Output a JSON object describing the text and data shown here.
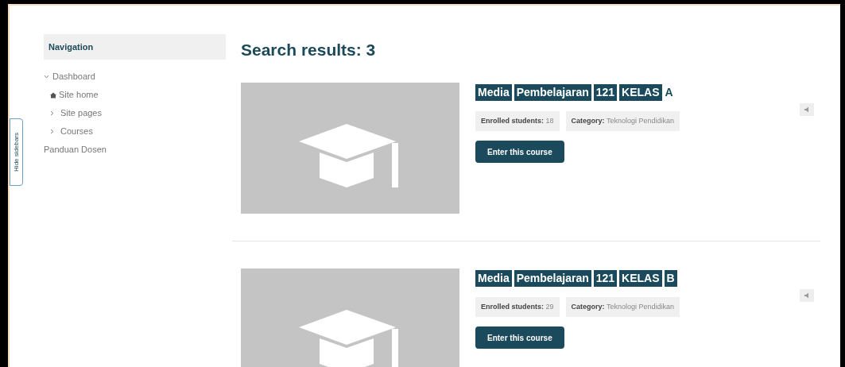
{
  "sidebar_toggle": {
    "label": "Hide sidebars"
  },
  "navigation": {
    "title": "Navigation",
    "items": [
      {
        "label": "Dashboard",
        "kind": "expanded",
        "children": [
          {
            "label": "Site home",
            "kind": "home"
          },
          {
            "label": "Site pages",
            "kind": "collapsed"
          },
          {
            "label": "Courses",
            "kind": "collapsed"
          }
        ]
      },
      {
        "label": "Panduan Dosen",
        "kind": "leaf"
      }
    ]
  },
  "heading": "Search results: 3",
  "courses": [
    {
      "title_words": [
        {
          "text": "Media",
          "highlighted": true
        },
        {
          "text": "Pembelajaran",
          "highlighted": true
        },
        {
          "text": "121",
          "highlighted": true
        },
        {
          "text": "KELAS",
          "highlighted": true
        },
        {
          "text": "A",
          "highlighted": false
        }
      ],
      "enrolled_label": "Enrolled students:",
      "enrolled": "18",
      "category_label": "Category:",
      "category": "Teknologi Pendidikan",
      "button": "Enter this course"
    },
    {
      "title_words": [
        {
          "text": "Media",
          "highlighted": true
        },
        {
          "text": "Pembelajaran",
          "highlighted": true
        },
        {
          "text": "121",
          "highlighted": true
        },
        {
          "text": "KELAS",
          "highlighted": true
        },
        {
          "text": "B",
          "highlighted": true
        }
      ],
      "enrolled_label": "Enrolled students:",
      "enrolled": "29",
      "category_label": "Category:",
      "category": "Teknologi Pendidikan",
      "button": "Enter this course"
    }
  ]
}
